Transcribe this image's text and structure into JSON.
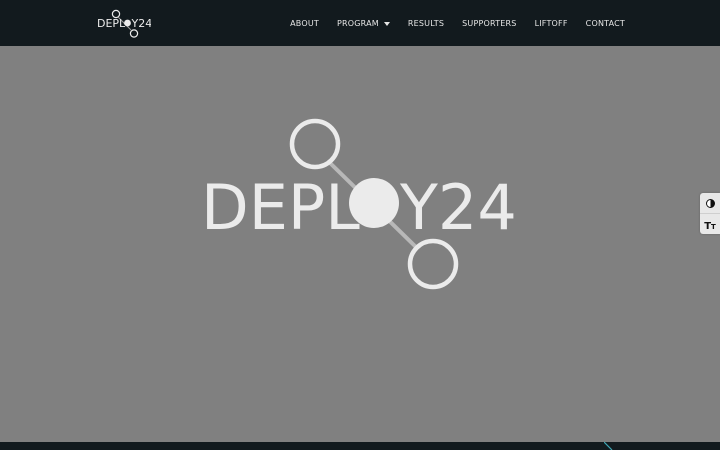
{
  "brand": {
    "logo_text": "DEPLOY24"
  },
  "nav": {
    "items": [
      {
        "label": "ABOUT"
      },
      {
        "label": "PROGRAM",
        "dropdown": true
      },
      {
        "label": "RESULTS"
      },
      {
        "label": "SUPPORTERS"
      },
      {
        "label": "LIFTOFF"
      },
      {
        "label": "CONTACT"
      }
    ]
  },
  "hero": {
    "logo_text": "DEPLOY24"
  },
  "a11y_toolbar": {
    "contrast_icon": "contrast-icon",
    "text_size_icon": "text-size-icon"
  },
  "colors": {
    "header_bg": "#121a1e",
    "hero_bg": "#808080",
    "logo_fg": "#ebebeb",
    "nav_text": "#e6e6e6",
    "accent_line": "#3fa7b5"
  }
}
